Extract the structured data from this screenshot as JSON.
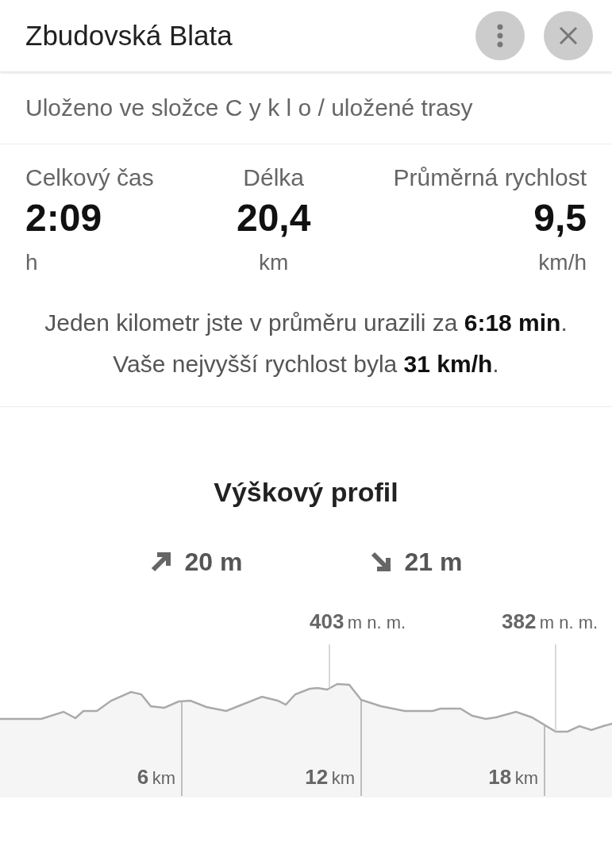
{
  "header": {
    "title": "Zbudovská Blata"
  },
  "folder_note": "Uloženo ve složce C y k l o / uložené trasy",
  "stats": [
    {
      "label": "Celkový čas",
      "value": "2:09",
      "unit": "h"
    },
    {
      "label": "Délka",
      "value": "20,4",
      "unit": "km"
    },
    {
      "label": "Průměrná rychlost",
      "value": "9,5",
      "unit": "km/h"
    }
  ],
  "summary": [
    "Jeden kilometr jste v průměru urazili za **6:18 min**.",
    "Vaše nejvyšší rychlost byla **31 km/h**."
  ],
  "profile": {
    "title": "Výškový profil",
    "ascent": "20 m",
    "descent": "21 m",
    "elevation_labels": [
      {
        "value": "403",
        "unit": "m n. m."
      },
      {
        "value": "382",
        "unit": "m n. m."
      }
    ],
    "distance_labels": [
      {
        "value": "6",
        "unit": "km"
      },
      {
        "value": "12",
        "unit": "km"
      },
      {
        "value": "18",
        "unit": "km"
      }
    ]
  }
}
